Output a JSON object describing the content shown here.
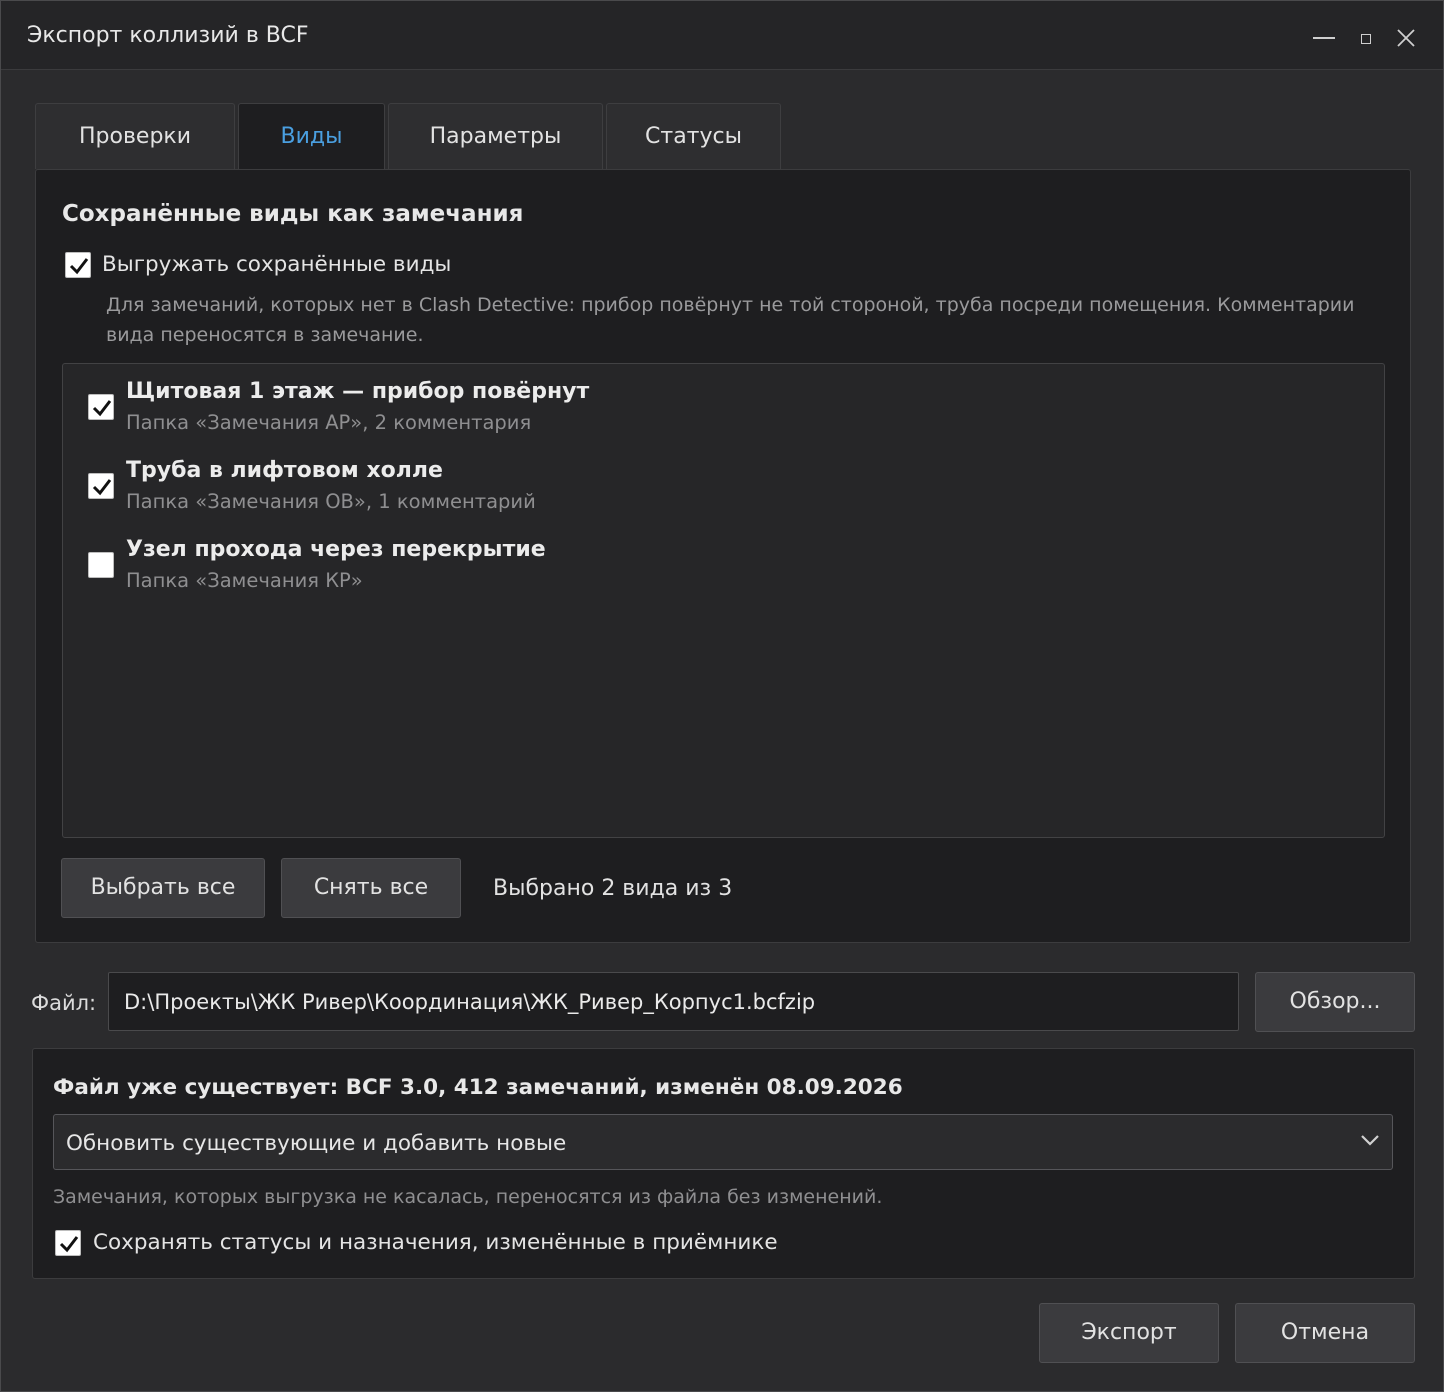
{
  "window": {
    "title": "Экспорт коллизий в BCF"
  },
  "tabs": [
    {
      "label": "Проверки",
      "active": false
    },
    {
      "label": "Виды",
      "active": true
    },
    {
      "label": "Параметры",
      "active": false
    },
    {
      "label": "Статусы",
      "active": false
    }
  ],
  "views_tab": {
    "section_title": "Сохранённые виды как замечания",
    "export_views_label": "Выгружать сохранённые виды",
    "export_views_checked": true,
    "hint": "Для замечаний, которых нет в Clash Detective: прибор повёрнут не той стороной, труба посреди помещения. Комментарии вида переносятся в замечание.",
    "items": [
      {
        "name": "Щитовая 1 этаж — прибор повёрнут",
        "sub": "Папка «Замечания АР», 2 комментария",
        "checked": true
      },
      {
        "name": "Труба в лифтовом холле",
        "sub": "Папка «Замечания ОВ», 1 комментарий",
        "checked": true
      },
      {
        "name": "Узел прохода через перекрытие",
        "sub": "Папка «Замечания КР»",
        "checked": false
      }
    ],
    "select_all_label": "Выбрать все",
    "clear_all_label": "Снять все",
    "selected_count": "Выбрано 2 вида из 3"
  },
  "file": {
    "label": "Файл:",
    "path": "D:\\Проекты\\ЖК Ривер\\Координация\\ЖК_Ривер_Корпус1.bcfzip",
    "browse_label": "Обзор..."
  },
  "existing": {
    "title": "Файл уже существует: BCF 3.0, 412 замечаний, изменён 08.09.2026",
    "mode_value": "Обновить существующие и добавить новые",
    "hint": "Замечания, которых выгрузка не касалась, переносятся из файла без изменений.",
    "keep_label": "Сохранять статусы и назначения, изменённые в приёмнике",
    "keep_checked": true
  },
  "footer": {
    "export_label": "Экспорт",
    "cancel_label": "Отмена"
  },
  "colors": {
    "accent": "#4a9fe0",
    "background": "#2b2b2d",
    "panel": "#1e1e20"
  }
}
